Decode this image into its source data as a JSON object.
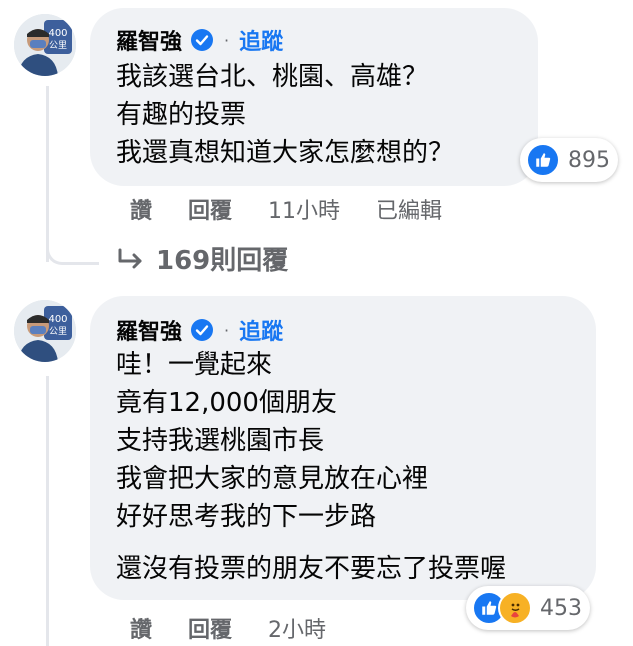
{
  "comments": [
    {
      "author": "羅智強",
      "follow_label": "追蹤",
      "separator": "·",
      "lines": [
        "我該選台北、桃園、高雄？",
        "有趣的投票",
        "我還真想知道大家怎麼想的？"
      ],
      "reaction_icons": [
        "like-icon"
      ],
      "reaction_count": "895",
      "actions": {
        "like": "讚",
        "reply": "回覆",
        "time": "11小時",
        "edited": "已編輯"
      },
      "replies_link": "169則回覆"
    },
    {
      "author": "羅智強",
      "follow_label": "追蹤",
      "separator": "·",
      "lines": [
        "哇！一覺起來",
        "竟有12,000個朋友",
        "支持我選桃園市長",
        "我會把大家的意見放在心裡",
        "好好思考我的下一步路"
      ],
      "extra_line": "還沒有投票的朋友不要忘了投票喔",
      "reaction_icons": [
        "like-icon",
        "care-icon"
      ],
      "reaction_count": "453",
      "actions": {
        "like": "讚",
        "reply": "回覆",
        "time": "2小時"
      }
    }
  ],
  "avatar_badge": "400公里",
  "colors": {
    "link": "#1877f2",
    "bubble": "#f0f2f5",
    "muted": "#65676b",
    "like": "#1877f2",
    "care": "#f7b125"
  }
}
